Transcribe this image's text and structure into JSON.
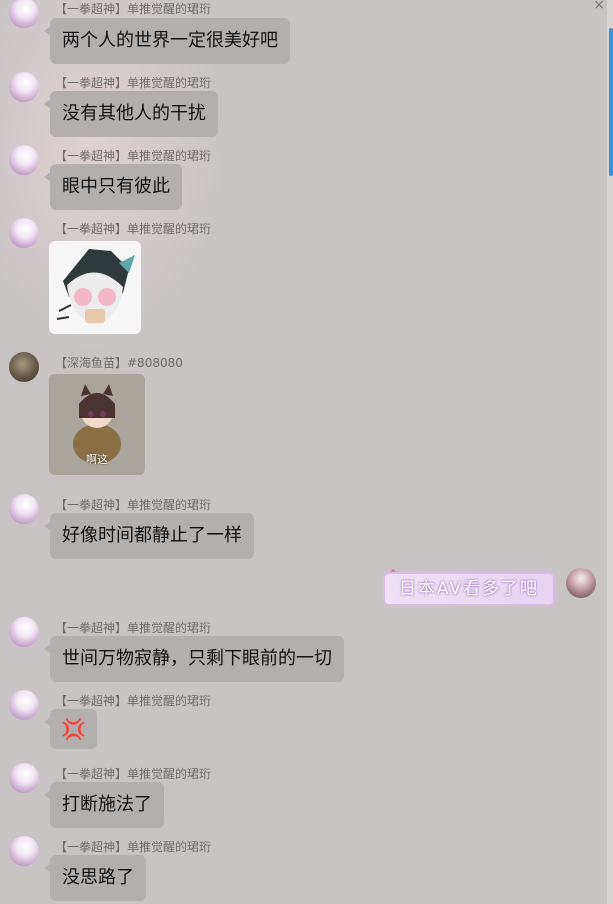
{
  "window": {
    "close_glyph": "×"
  },
  "messages": [
    {
      "nick": "【一拳超神】单推觉醒的珺珩",
      "text": "两个人的世界一定很美好吧"
    },
    {
      "nick": "【一拳超神】单推觉醒的珺珩",
      "text": "没有其他人的干扰"
    },
    {
      "nick": "【一拳超神】单推觉醒的珺珩",
      "text": "眼中只有彼此"
    },
    {
      "nick": "【一拳超神】单推觉醒的珺珩",
      "sticker": "anime-girl-sticker"
    },
    {
      "nick": "【深海鱼苗】#808080",
      "sticker": "cat-girl-potato-sticker",
      "caption": "啊这"
    },
    {
      "nick": "【一拳超神】单推觉醒的珺珩",
      "text": "好像时间都静止了一样"
    },
    {
      "self": true,
      "text": "日本AV看多了吧"
    },
    {
      "nick": "【一拳超神】单推觉醒的珺珩",
      "text": "世间万物寂静，只剩下眼前的一切"
    },
    {
      "nick": "【一拳超神】单推觉醒的珺珩",
      "emoji": "anger-symbol-icon",
      "glyph": "💢"
    },
    {
      "nick": "【一拳超神】单推觉醒的珺珩",
      "text": "打断施法了"
    },
    {
      "nick": "【一拳超神】单推觉醒的珺珩",
      "text": "没思路了"
    }
  ],
  "colors": {
    "bubble": "#b3afaf",
    "background": "#c8c4c4",
    "scroll_accent": "#3a8fd6"
  }
}
